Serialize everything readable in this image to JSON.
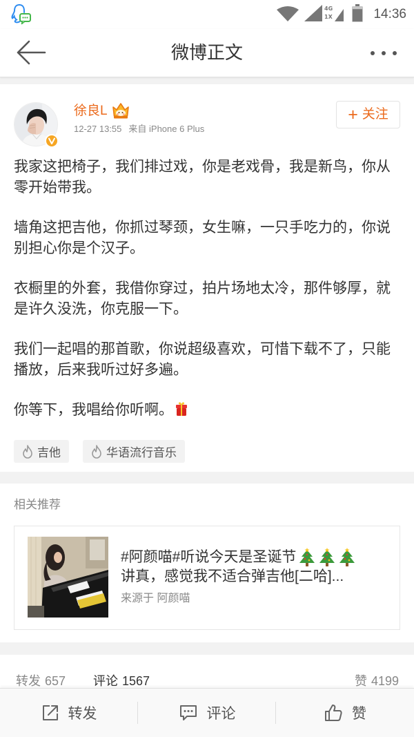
{
  "status_bar": {
    "notification_icon": "qq-notification-icon",
    "network_top": "4G",
    "network_bottom": "1X",
    "battery_level": 0.85,
    "time": "14:36"
  },
  "header": {
    "back_icon": "back-arrow-icon",
    "title": "微博正文",
    "more_icon": "more-icon"
  },
  "post": {
    "author": {
      "name": "徐良L",
      "verified": true,
      "vip_icon": "crown-icon"
    },
    "time": "12-27 13:55",
    "source": "来自 iPhone 6 Plus",
    "follow": {
      "plus": "+",
      "label": "关注"
    },
    "paragraphs": [
      [
        "我家这把椅子，我们排过戏，你是老戏骨，我是新鸟，你从",
        "零开始带我。"
      ],
      [
        "墙角这把吉他，你抓过琴颈，女生嘛，一只手吃力的，你说",
        "别担心你是个汉子。"
      ],
      [
        "衣橱里的外套，我借你穿过，拍片场地太冷，那件够厚，就",
        "是许久没洗，你克服一下。"
      ],
      [
        "我们一起唱的那首歌，你说超级喜欢，可惜下载不了，只能",
        "播放，后来我听过好多遍。"
      ]
    ],
    "closing_line": "你等下，我唱给你听啊。",
    "closing_icon": "gift-icon",
    "tags": [
      {
        "label": "吉他",
        "icon": "fire-icon"
      },
      {
        "label": "华语流行音乐",
        "icon": "fire-icon"
      }
    ]
  },
  "related": {
    "label": "相关推荐",
    "item": {
      "title": "#阿颜喵#听说今天是圣诞节",
      "title_icons": [
        "christmas-tree-icon",
        "christmas-tree-icon",
        "christmas-tree-icon"
      ],
      "excerpt": "讲真，感觉我不适合弹吉他[二哈]...",
      "source": "来源于 阿颜喵"
    }
  },
  "stats": {
    "reposts": {
      "label": "转发",
      "count": "657"
    },
    "comments": {
      "label": "评论",
      "count": "1567",
      "active": true
    },
    "likes": {
      "label": "赞",
      "count": "4199"
    }
  },
  "toolbar": {
    "repost": {
      "label": "转发",
      "icon": "repost-icon"
    },
    "comment": {
      "label": "评论",
      "icon": "comment-icon"
    },
    "like": {
      "label": "赞",
      "icon": "like-icon"
    }
  },
  "colors": {
    "accent": "#eb6a1c",
    "text": "#333333",
    "muted": "#888888",
    "divider_bg": "#f2f2f2",
    "verified": "#f6a623"
  }
}
